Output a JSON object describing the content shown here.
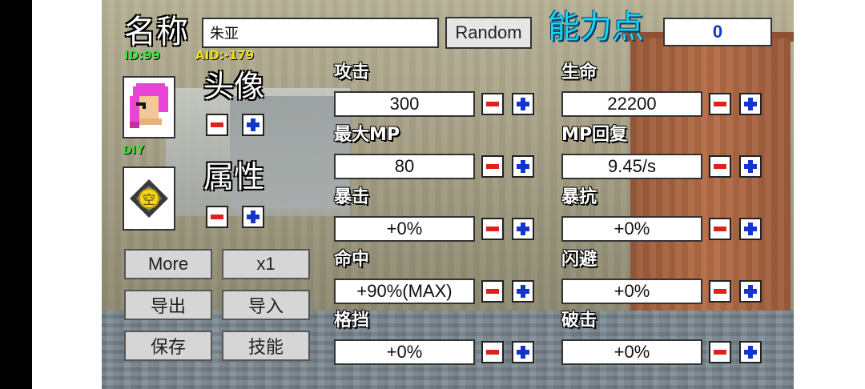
{
  "header": {
    "name_label": "名称",
    "name_value": "朱亚",
    "random_label": "Random",
    "points_label": "能力点",
    "points_value": "0",
    "id_text": "ID:99",
    "aid_text": "AID:-179"
  },
  "avatar": {
    "label": "头像",
    "tag": "DIY"
  },
  "element": {
    "label": "属性",
    "glyph": "空"
  },
  "buttons": {
    "more": "More",
    "multiplier": "x1",
    "export": "导出",
    "import": "导入",
    "save": "保存",
    "skills": "技能"
  },
  "stats": [
    {
      "label": "攻击",
      "value": "300"
    },
    {
      "label": "生命",
      "value": "22200"
    },
    {
      "label": "最大MP",
      "value": "80"
    },
    {
      "label": "MP回复",
      "value": "9.45/s"
    },
    {
      "label": "暴击",
      "value": "+0%"
    },
    {
      "label": "暴抗",
      "value": "+0%"
    },
    {
      "label": "命中",
      "value": "+90%(MAX)"
    },
    {
      "label": "闪避",
      "value": "+0%"
    },
    {
      "label": "格挡",
      "value": "+0%"
    },
    {
      "label": "破击",
      "value": "+0%"
    }
  ],
  "colors": {
    "minus": "#e0201a",
    "plus": "#1436c8",
    "points_title": "#16d7f0",
    "points_value": "#1436c8",
    "id_green": "#3ce03c",
    "aid_yellow": "#f0e020"
  }
}
